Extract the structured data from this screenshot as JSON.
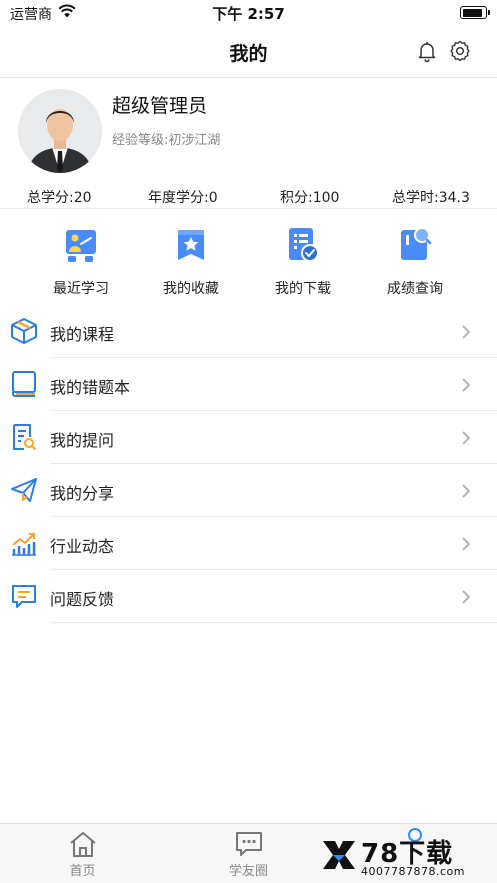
{
  "status_bar": {
    "carrier": "运营商",
    "time": "下午 2:57",
    "battery_level": 0.9
  },
  "nav": {
    "title": "我的",
    "bell_icon": "bell-icon",
    "settings_icon": "gear-icon"
  },
  "profile": {
    "name": "超级管理员",
    "level": "经验等级:初涉江湖"
  },
  "stats": [
    {
      "label": "总学分:20"
    },
    {
      "label": "年度学分:0"
    },
    {
      "label": "积分:100"
    },
    {
      "label": "总学时:34.3"
    }
  ],
  "quick_actions": [
    {
      "label": "最近学习",
      "icon": "teacher-board-icon"
    },
    {
      "label": "我的收藏",
      "icon": "star-bookmark-icon"
    },
    {
      "label": "我的下载",
      "icon": "download-check-icon"
    },
    {
      "label": "成绩查询",
      "icon": "score-search-icon"
    }
  ],
  "menu": [
    {
      "label": "我的课程",
      "icon": "box-icon"
    },
    {
      "label": "我的错题本",
      "icon": "notebook-icon"
    },
    {
      "label": "我的提问",
      "icon": "document-search-icon"
    },
    {
      "label": "我的分享",
      "icon": "paper-plane-icon"
    },
    {
      "label": "行业动态",
      "icon": "trend-chart-icon"
    },
    {
      "label": "问题反馈",
      "icon": "feedback-icon"
    }
  ],
  "tabs": [
    {
      "label": "首页",
      "icon": "home-icon"
    },
    {
      "label": "学友圈",
      "icon": "chat-icon"
    },
    {
      "label": "",
      "icon": "profile-icon"
    }
  ],
  "watermark": {
    "brand": "78下载",
    "url": "4007787878.com"
  },
  "colors": {
    "accent": "#2f8df3",
    "icon_blue": "#3b82f6",
    "icon_orange": "#f5a623",
    "text": "#222222",
    "muted": "#888888"
  }
}
